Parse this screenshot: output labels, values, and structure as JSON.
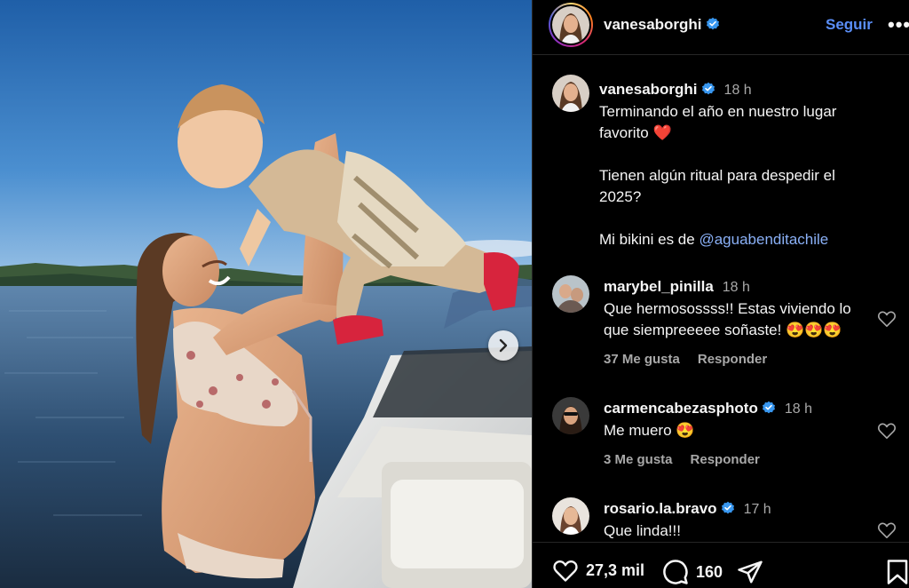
{
  "post": {
    "image_alt": "Mujer embarazada en bikini levantando a un bebé junto a un bote en un lago al atardecer",
    "next_icon": "chevron-right-icon"
  },
  "header": {
    "username": "vanesaborghi",
    "verified": true,
    "follow_label": "Seguir",
    "more_label": "•••"
  },
  "caption": {
    "username": "vanesaborghi",
    "time": "18 h",
    "line1": "Terminando el año en nuestro lugar",
    "line2": "favorito",
    "heart": "❤️",
    "line3": "Tienen algún ritual para despedir el",
    "line4": "2025?",
    "line5_prefix": "Mi bikini es de",
    "mention": "@aguabenditachile"
  },
  "comments": [
    {
      "username": "marybel_pinilla",
      "verified": false,
      "time": "18 h",
      "text_line1": "Que hermosossss!! Estas viviendo lo",
      "text_line2": "que siempreeeee soñaste! 😍😍😍",
      "likes": "37 Me gusta",
      "reply": "Responder"
    },
    {
      "username": "carmencabezasphoto",
      "verified": true,
      "time": "18 h",
      "text_line1": "Me muero 😍",
      "likes": "3 Me gusta",
      "reply": "Responder"
    },
    {
      "username": "rosario.la.bravo",
      "verified": true,
      "time": "17 h",
      "text_line1": "Que linda!!!"
    }
  ],
  "actions": {
    "likes": "27,3 mil",
    "comments": "160"
  },
  "colors": {
    "background": "#000000",
    "text": "#f5f5f5",
    "secondary_text": "#a8a8a8",
    "link": "#8ab0f6",
    "follow": "#5a8ef7",
    "verified": "#3897f0"
  }
}
